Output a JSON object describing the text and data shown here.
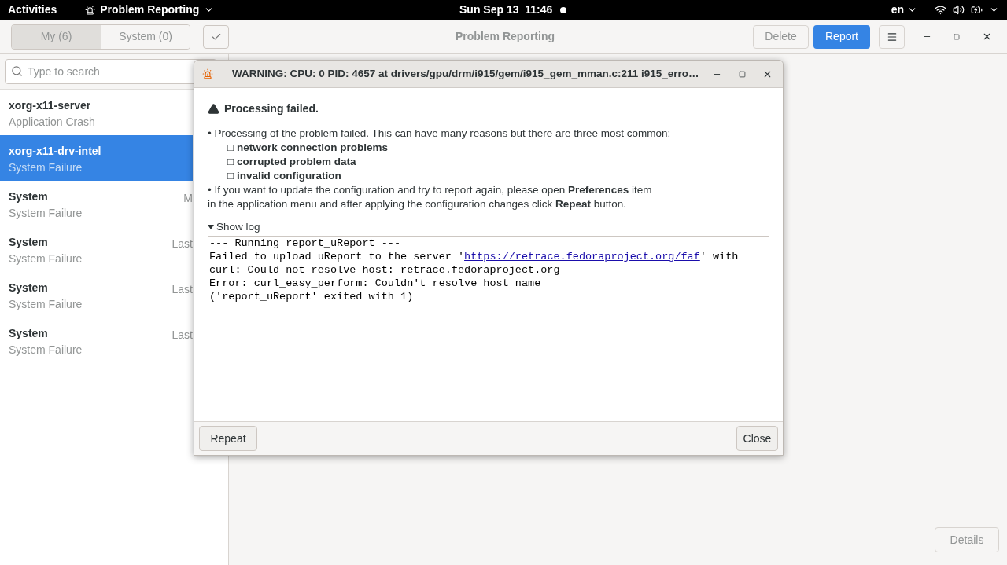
{
  "top_bar": {
    "activities": "Activities",
    "app_menu": "Problem Reporting",
    "clock": "Sun Sep 13  11:46",
    "keyboard": "en"
  },
  "header": {
    "tabs": [
      {
        "label": "My (6)",
        "selected": true
      },
      {
        "label": "System (0)",
        "selected": false
      }
    ],
    "title": "Problem Reporting",
    "delete_button": {
      "label": "Delete",
      "disabled": true
    },
    "report_button": "Report"
  },
  "search": {
    "placeholder": "Type to search"
  },
  "problems": [
    {
      "name": "xorg-x11-server",
      "type": "Application Crash",
      "selected": false
    },
    {
      "name": "xorg-x11-drv-intel",
      "type": "System Failure",
      "selected": true
    },
    {
      "name": "System",
      "type": "System Failure",
      "time": "M",
      "selected": false
    },
    {
      "name": "System",
      "type": "System Failure",
      "time": "Last",
      "selected": false
    },
    {
      "name": "System",
      "type": "System Failure",
      "time": "Last",
      "selected": false
    },
    {
      "name": "System",
      "type": "System Failure",
      "time": "Last",
      "selected": false
    }
  ],
  "details_button": "Details",
  "dialog": {
    "title": "WARNING: CPU: 0 PID: 4657 at drivers/gpu/drm/i915/gem/i915_gem_mman.c:211 i915_erro…",
    "heading": "Processing failed.",
    "message": [
      {
        "kind": "bullet",
        "text": "• Processing of the problem failed. This can have many reasons but there are three most common:"
      },
      {
        "kind": "sub",
        "text": "□ **network connection problems**"
      },
      {
        "kind": "sub",
        "text": "□ **corrupted problem data**"
      },
      {
        "kind": "sub",
        "text": "□ **invalid configuration**"
      },
      {
        "kind": "bullet",
        "text": "• If you want to update the configuration and try to report again, please open **Preferences** item"
      },
      {
        "kind": "bullet",
        "text": "in the application menu and after applying the configuration changes click **Repeat** button."
      }
    ],
    "log_expander": {
      "label": "Show log",
      "expanded": true
    },
    "log": [
      {
        "text": "--- Running report_uReport ---"
      },
      {
        "text": "Failed to upload uReport to the server '",
        "link": "https://retrace.fedoraproject.org/faf",
        "after": "' with"
      },
      {
        "text": "curl: Could not resolve host: retrace.fedoraproject.org"
      },
      {
        "text": "Error: curl_easy_perform: Couldn't resolve host name"
      },
      {
        "text": "('report_uReport' exited with 1)"
      }
    ],
    "repeat_button": "Repeat",
    "close_button": "Close"
  }
}
